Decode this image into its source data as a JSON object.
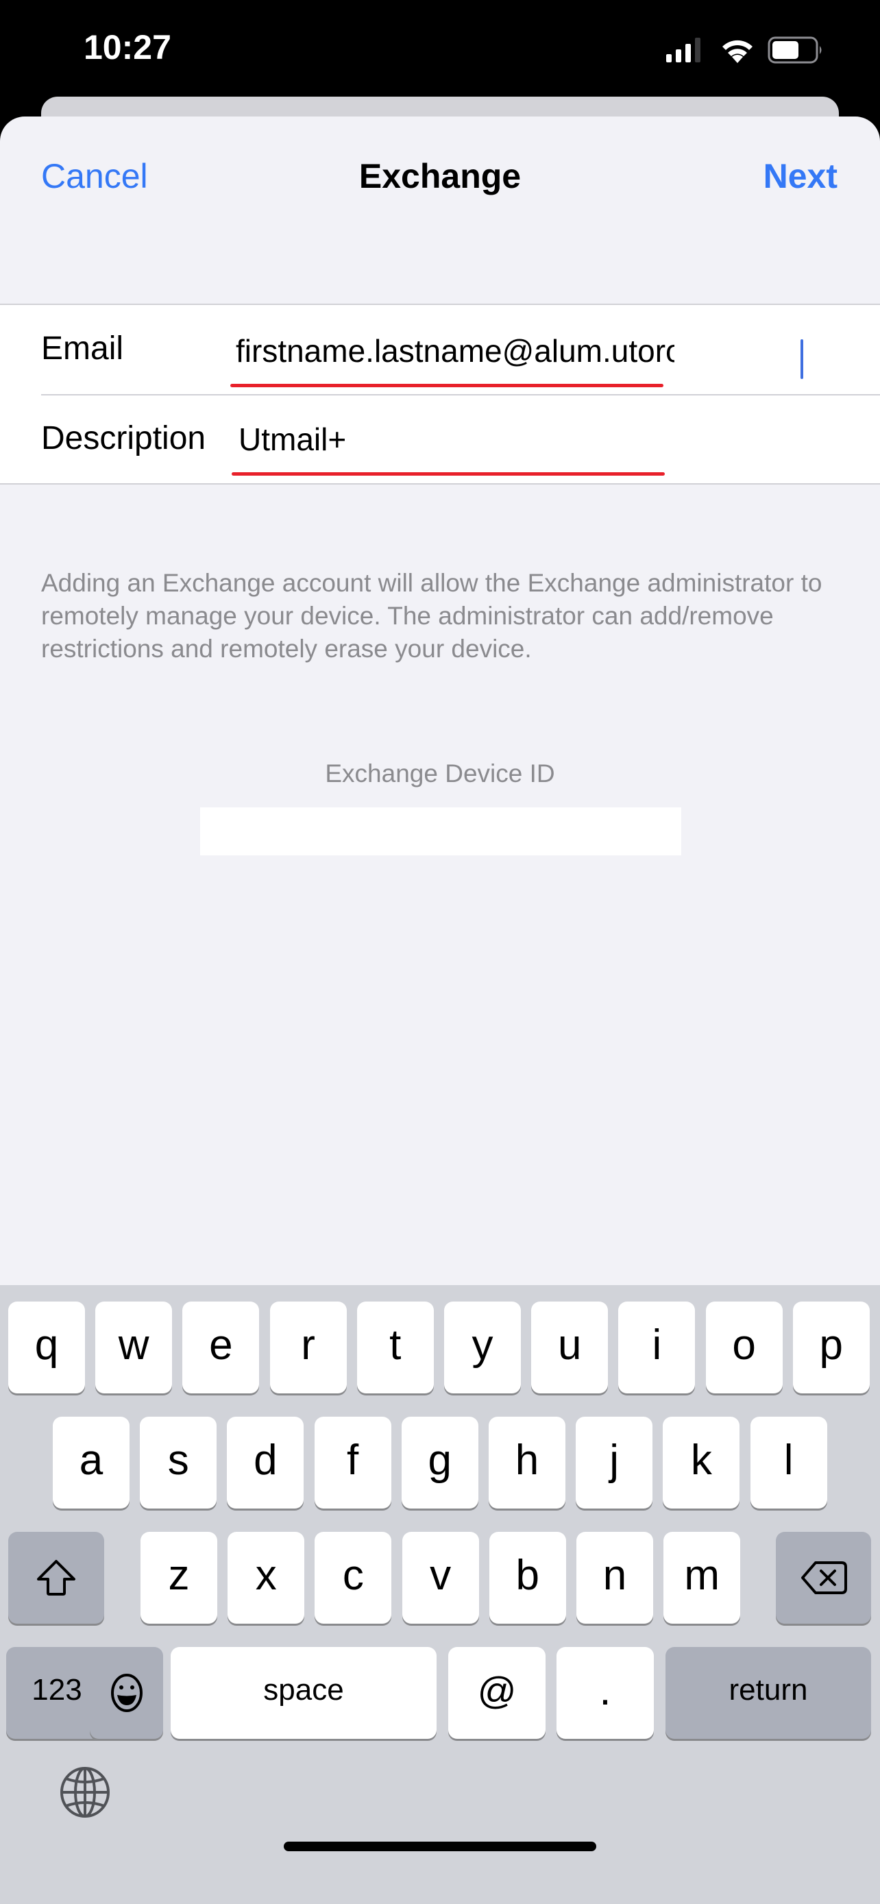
{
  "status_bar": {
    "time": "10:27",
    "signal_bars_active": 3,
    "signal_bars_total": 4,
    "wifi": "connected",
    "battery_level_fraction": 0.6
  },
  "colors": {
    "accent": "#3478f6",
    "sheet_background": "#f2f2f7",
    "keyboard_background": "#d1d3d9",
    "dark_key": "#abafba",
    "annotation_red": "#e8202a",
    "caret": "#3f6fe0",
    "secondary_text": "#8a8a8e"
  },
  "nav": {
    "cancel_label": "Cancel",
    "title": "Exchange",
    "next_label": "Next"
  },
  "form": {
    "email": {
      "label": "Email",
      "value": "firstname.lastname@alum.utoronto.ca"
    },
    "description": {
      "label": "Description",
      "value": "Utmail+"
    }
  },
  "footer": {
    "notice": "Adding an Exchange account will allow the Exchange administrator to remotely manage your device. The administrator can add/remove restrictions and remotely erase your device.",
    "device_id_label": "Exchange Device ID",
    "device_id_value": ""
  },
  "keyboard": {
    "row1": [
      "q",
      "w",
      "e",
      "r",
      "t",
      "y",
      "u",
      "i",
      "o",
      "p"
    ],
    "row2": [
      "a",
      "s",
      "d",
      "f",
      "g",
      "h",
      "j",
      "k",
      "l"
    ],
    "row3": [
      "z",
      "x",
      "c",
      "v",
      "b",
      "n",
      "m"
    ],
    "shift_icon": "shift-arrow-icon",
    "delete_icon": "backspace-icon",
    "numbers_label": "123",
    "emoji_icon": "emoji-smile-icon",
    "space_label": "space",
    "at_label": "@",
    "period_label": ".",
    "return_label": "return",
    "globe_icon": "globe-icon"
  }
}
